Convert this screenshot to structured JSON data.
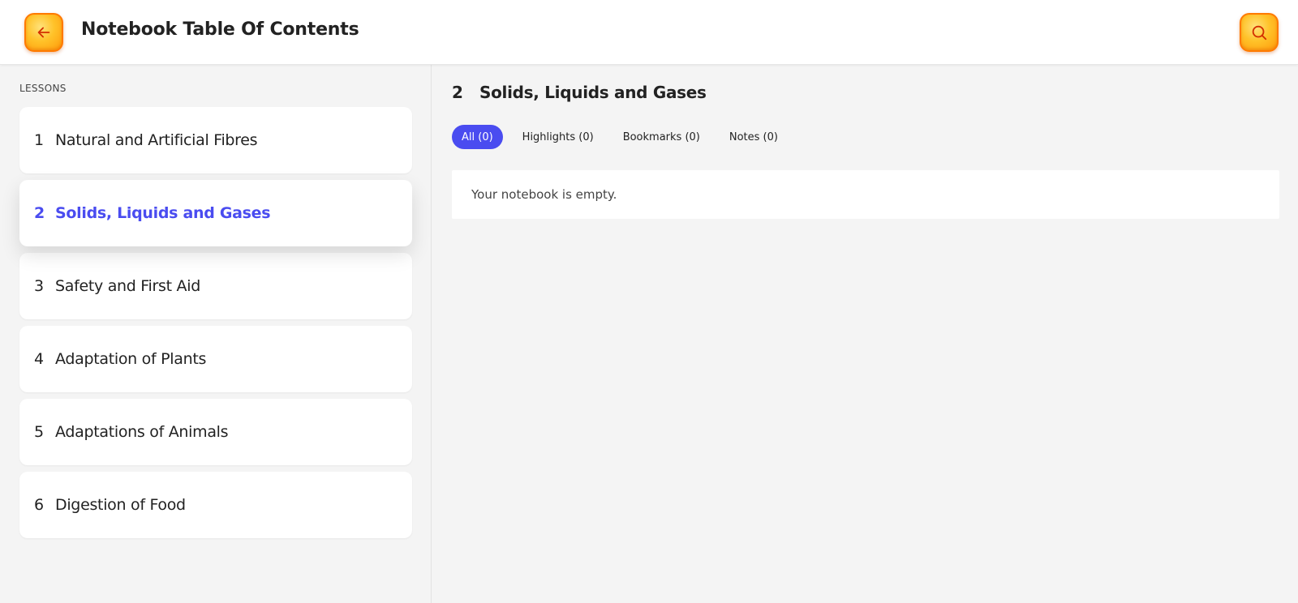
{
  "header": {
    "title": "Notebook Table Of Contents",
    "back_icon": "arrow-left-icon",
    "search_icon": "search-icon",
    "accent": "#ffc229"
  },
  "sidebar": {
    "heading": "LESSONS",
    "lessons": [
      {
        "num": "1",
        "label": "Natural and Artificial Fibres"
      },
      {
        "num": "2",
        "label": "Solids, Liquids and Gases"
      },
      {
        "num": "3",
        "label": "Safety and First Aid"
      },
      {
        "num": "4",
        "label": "Adaptation of Plants"
      },
      {
        "num": "5",
        "label": "Adaptations of Animals"
      },
      {
        "num": "6",
        "label": "Digestion of Food"
      }
    ],
    "active_index": 1,
    "active_color": "#4a4cf0"
  },
  "main": {
    "num": "2",
    "title": "Solids, Liquids and Gases",
    "tabs": [
      {
        "label": "All (0)",
        "active": true
      },
      {
        "label": "Highlights (0)",
        "active": false
      },
      {
        "label": "Bookmarks (0)",
        "active": false
      },
      {
        "label": "Notes (0)",
        "active": false
      }
    ],
    "empty_message": "Your notebook is empty."
  }
}
